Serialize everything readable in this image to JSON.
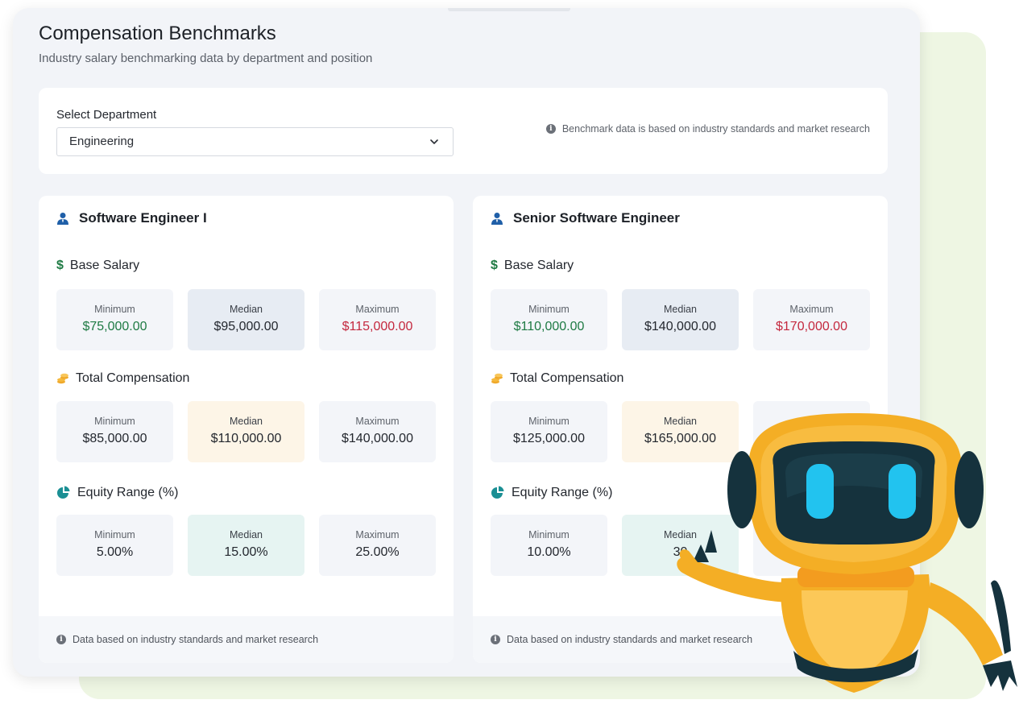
{
  "header": {
    "title": "Compensation Benchmarks",
    "subtitle": "Industry salary benchmarking data by department and position"
  },
  "department_select": {
    "label": "Select Department",
    "value": "Engineering",
    "notice": "Benchmark data is based on industry standards and market research"
  },
  "colors": {
    "min_text": "#1e7a43",
    "max_text": "#c4283e",
    "base_median_bg": "#e7ecf3",
    "total_median_bg": "#fdf5e7",
    "equity_median_bg": "#e6f4f2",
    "accent_blue": "#1f5fa8"
  },
  "positions": [
    {
      "title": "Software Engineer I",
      "icon": "user-tie-icon",
      "base_salary": {
        "label": "Base Salary",
        "icon": "dollar-icon",
        "min_label": "Minimum",
        "min": "$75,000.00",
        "median_label": "Median",
        "median": "$95,000.00",
        "max_label": "Maximum",
        "max": "$115,000.00"
      },
      "total_comp": {
        "label": "Total Compensation",
        "icon": "coins-icon",
        "min_label": "Minimum",
        "min": "$85,000.00",
        "median_label": "Median",
        "median": "$110,000.00",
        "max_label": "Maximum",
        "max": "$140,000.00"
      },
      "equity": {
        "label": "Equity Range (%)",
        "icon": "pie-chart-icon",
        "min_label": "Minimum",
        "min": "5.00%",
        "median_label": "Median",
        "median": "15.00%",
        "max_label": "Maximum",
        "max": "25.00%"
      },
      "footer": "Data based on industry standards and market research"
    },
    {
      "title": "Senior Software Engineer",
      "icon": "user-tie-icon",
      "base_salary": {
        "label": "Base Salary",
        "icon": "dollar-icon",
        "min_label": "Minimum",
        "min": "$110,000.00",
        "median_label": "Median",
        "median": "$140,000.00",
        "max_label": "Maximum",
        "max": "$170,000.00"
      },
      "total_comp": {
        "label": "Total Compensation",
        "icon": "coins-icon",
        "min_label": "Minimum",
        "min": "$125,000.00",
        "median_label": "Median",
        "median": "$165,000.00"
      },
      "equity": {
        "label": "Equity Range (%)",
        "icon": "pie-chart-icon",
        "min_label": "Minimum",
        "min": "10.00%",
        "median_label": "Median",
        "median": "30"
      },
      "footer": "Data based on industry standards and market research"
    }
  ]
}
